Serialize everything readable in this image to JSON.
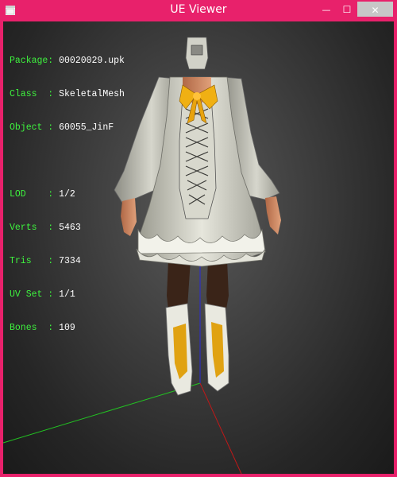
{
  "window": {
    "title": "UE Viewer",
    "minimize_glyph": "—",
    "maximize_glyph": "☐",
    "close_glyph": "✕",
    "frame_color": "#e8216b"
  },
  "info": {
    "package_label": "Package:",
    "package_value": "00020029.upk",
    "class_label": "Class  :",
    "class_value": "SkeletalMesh",
    "object_label": "Object :",
    "object_value": "60055_JinF",
    "lod_label": "LOD    :",
    "lod_value": "1/2",
    "verts_label": "Verts  :",
    "verts_value": "5463",
    "tris_label": "Tris   :",
    "tris_value": "7334",
    "uvset_label": "UV Set :",
    "uvset_value": "1/1",
    "bones_label": "Bones  :",
    "bones_value": "109"
  },
  "scene": {
    "model": "skeletal-mesh-dress-outfit",
    "axes": [
      "x-axis-red",
      "y-axis-green",
      "z-axis-blue"
    ]
  }
}
